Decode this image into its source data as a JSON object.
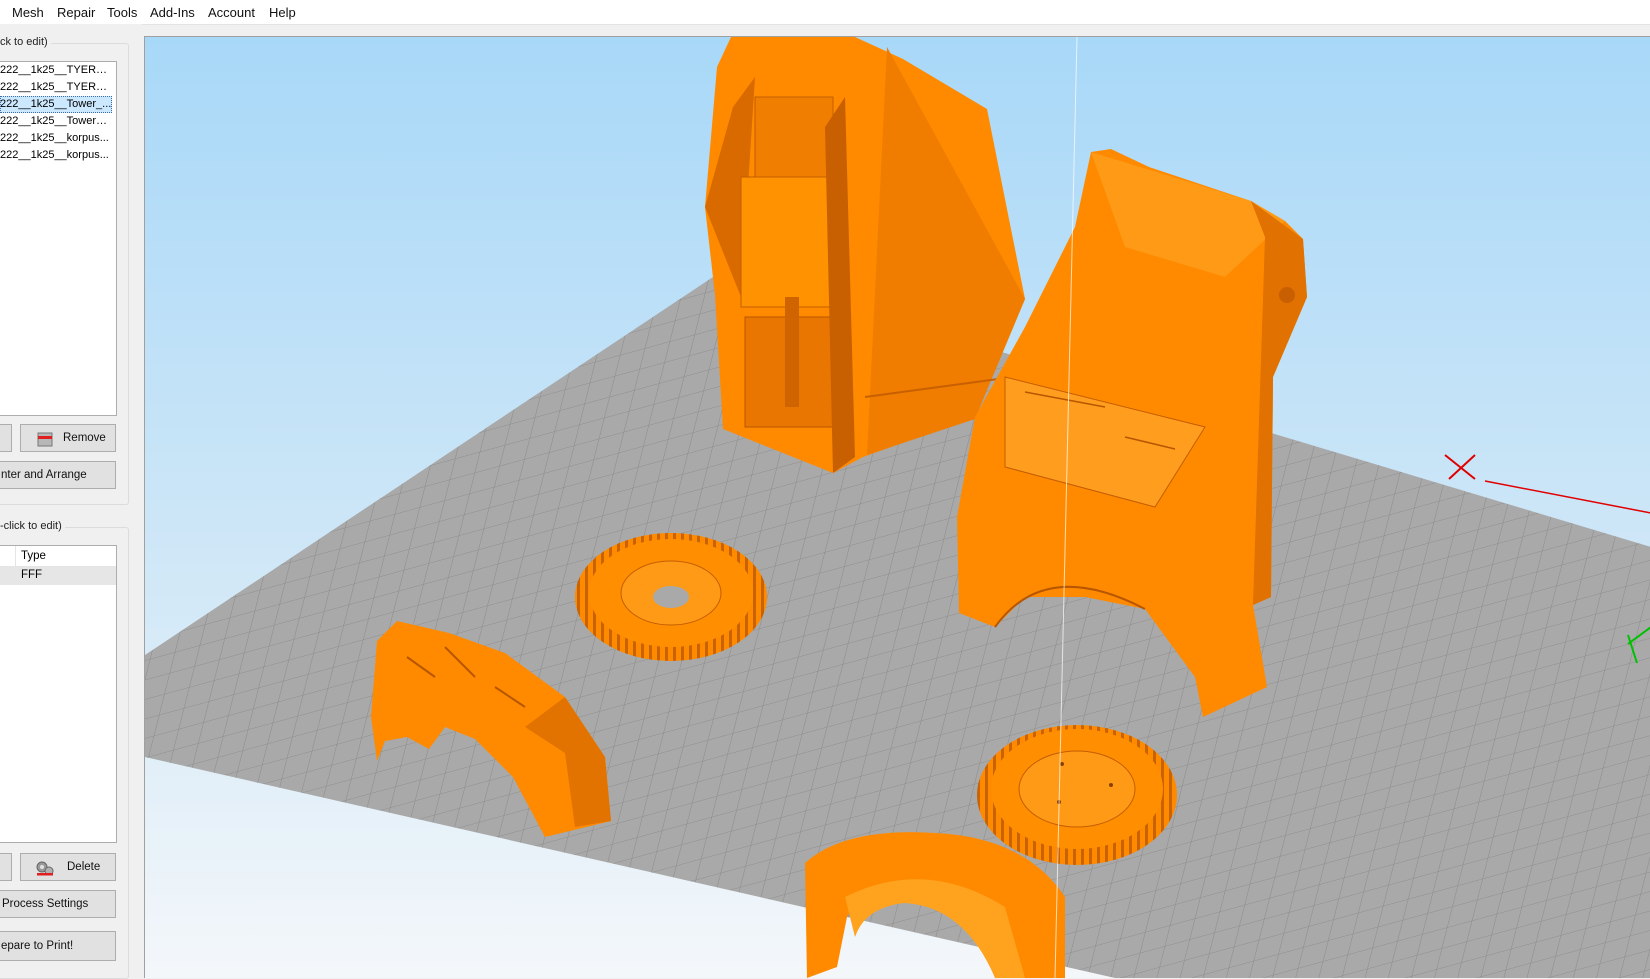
{
  "menu": [
    "Mesh",
    "Repair",
    "Tools",
    "Add-Ins",
    "Account",
    "Help"
  ],
  "models_panel": {
    "title": "ck to edit)",
    "items": [
      "222__1k25__TYERS_...",
      "222__1k25__TYERS_...",
      "222__1k25__Tower_...",
      "222__1k25__Tower__F",
      "222__1k25__korpus...",
      "222__1k25__korpus..."
    ],
    "selected_index": 2,
    "remove_label": "Remove",
    "center_arrange_label": "nter and Arrange"
  },
  "processes_panel": {
    "title": "-click to edit)",
    "column_type": "Type",
    "row_type": "FFF",
    "delete_label": "Delete",
    "process_settings_label": "Process Settings",
    "prepare_label": "epare to Print!"
  },
  "colors": {
    "model_orange": "#ff8a00",
    "model_shadow": "#c85f00",
    "bed_gray": "#a9a9a9",
    "sky_top": "#a8d8f8",
    "sky_bottom": "#f4f7fa",
    "axis_x": "#e00000",
    "axis_y": "#00c000"
  }
}
